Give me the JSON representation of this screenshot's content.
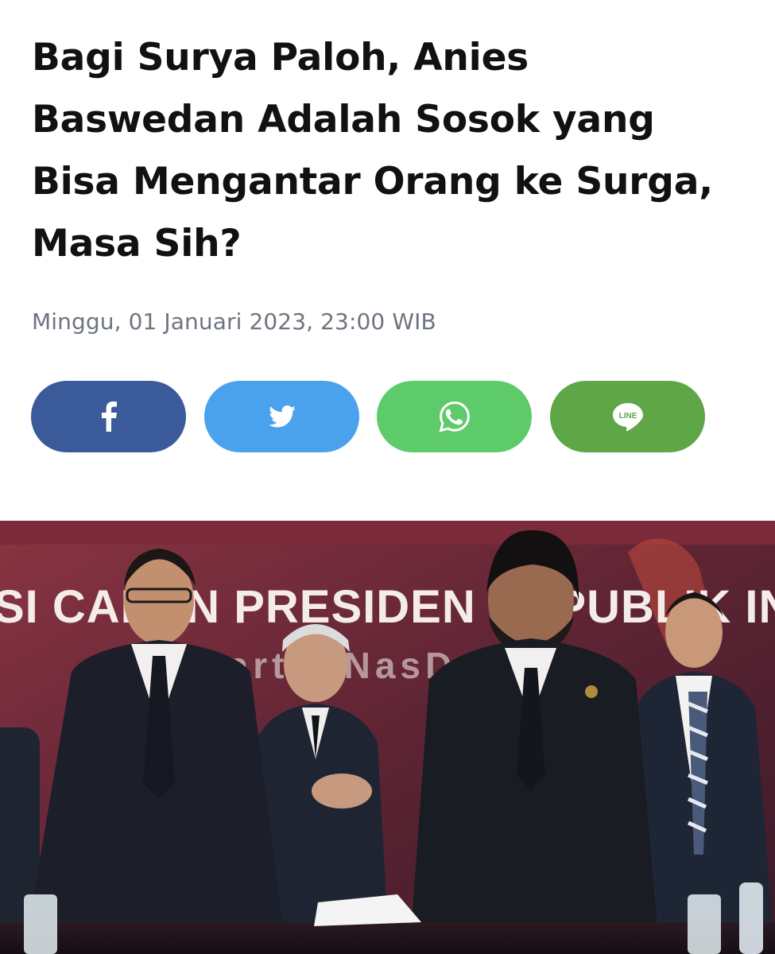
{
  "article": {
    "headline": "Bagi Surya Paloh, Anies Baswedan Adalah Sosok yang Bisa Mengantar Orang ke Surga, Masa Sih?",
    "dateline": "Minggu, 01 Januari 2023, 23:00 WIB"
  },
  "share": {
    "buttons": [
      {
        "network": "facebook",
        "icon": "facebook-icon",
        "color": "#3b5a9a"
      },
      {
        "network": "twitter",
        "icon": "twitter-icon",
        "color": "#4aa1ec"
      },
      {
        "network": "whatsapp",
        "icon": "whatsapp-icon",
        "color": "#5ecb6b"
      },
      {
        "network": "line",
        "icon": "line-icon",
        "label": "LINE",
        "color": "#5ea646"
      }
    ]
  },
  "photo": {
    "backdrop_text": "SI CALON PRESIDEN REPUBLIK INDONESIA",
    "backdrop_subtext": "Partai NasDem",
    "colors": {
      "backdrop": "#6e2a3a",
      "suit": "#1c1f2a",
      "shirt": "#f2f0ee"
    }
  }
}
